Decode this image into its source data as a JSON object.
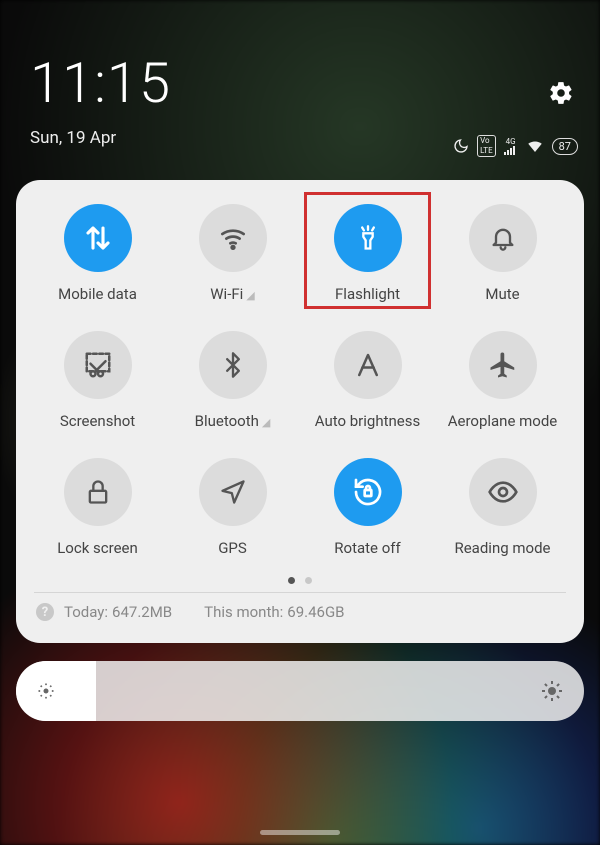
{
  "status": {
    "clock": "11:15",
    "date": "Sun, 19 Apr",
    "battery": "87",
    "network_label": "4G",
    "volte_label": "Vo\nLTE"
  },
  "tiles": [
    {
      "label": "Mobile data",
      "icon": "data-arrows",
      "active": true
    },
    {
      "label": "Wi-Fi",
      "icon": "wifi",
      "active": false,
      "chevron": true
    },
    {
      "label": "Flashlight",
      "icon": "flashlight",
      "active": true,
      "highlight": true
    },
    {
      "label": "Mute",
      "icon": "bell",
      "active": false
    },
    {
      "label": "Screenshot",
      "icon": "scissors",
      "active": false
    },
    {
      "label": "Bluetooth",
      "icon": "bluetooth",
      "active": false,
      "chevron": true
    },
    {
      "label": "Auto brightness",
      "icon": "letter-a",
      "active": false
    },
    {
      "label": "Aeroplane mode",
      "icon": "airplane",
      "active": false
    },
    {
      "label": "Lock screen",
      "icon": "lock",
      "active": false
    },
    {
      "label": "GPS",
      "icon": "nav-arrow",
      "active": false
    },
    {
      "label": "Rotate off",
      "icon": "rotate-lock",
      "active": true
    },
    {
      "label": "Reading mode",
      "icon": "eye",
      "active": false
    }
  ],
  "usage": {
    "today_label": "Today:",
    "today_value": "647.2MB",
    "month_label": "This month:",
    "month_value": "69.46GB"
  },
  "brightness_level_pct": 14
}
